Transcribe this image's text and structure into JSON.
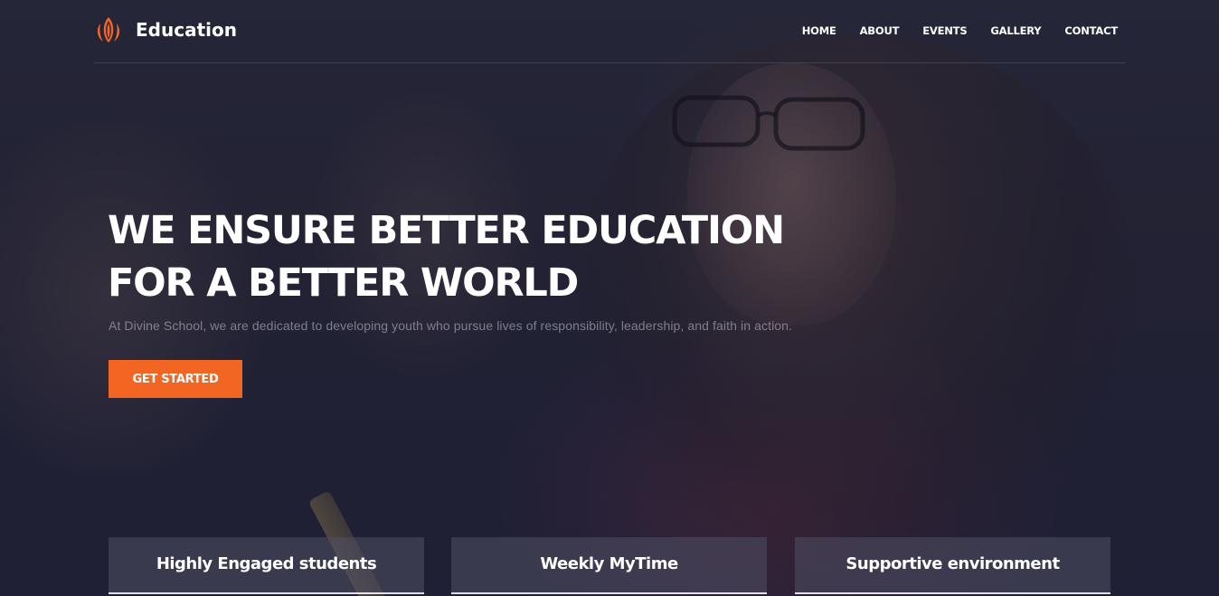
{
  "brand": {
    "name": "Education",
    "logo_icon": "flame-logo-icon",
    "accent_color": "#f26522"
  },
  "nav": {
    "items": [
      {
        "label": "HOME"
      },
      {
        "label": "ABOUT"
      },
      {
        "label": "EVENTS"
      },
      {
        "label": "GALLERY"
      },
      {
        "label": "CONTACT"
      }
    ]
  },
  "hero": {
    "title_line1": "WE ENSURE BETTER EDUCATION",
    "title_line2": "FOR A BETTER WORLD",
    "subtitle": "At Divine School, we are dedicated to developing youth who pursue lives of responsibility, leadership, and faith in action.",
    "cta_label": "GET STARTED"
  },
  "features": [
    {
      "title": "Highly Engaged students"
    },
    {
      "title": "Weekly MyTime"
    },
    {
      "title": "Supportive environment"
    }
  ]
}
